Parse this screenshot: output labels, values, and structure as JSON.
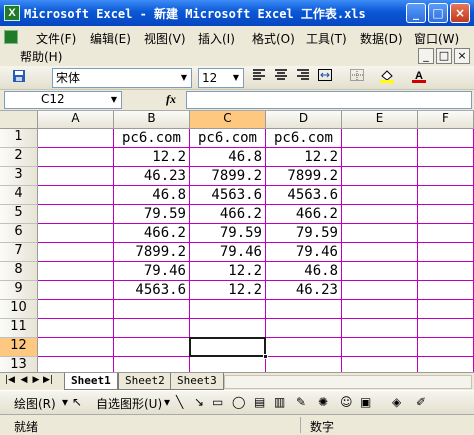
{
  "window": {
    "title": "Microsoft Excel - 新建 Microsoft Excel 工作表.xls",
    "app_icon_letter": "X",
    "minimize": "_",
    "maximize": "□",
    "close": "×"
  },
  "menu": {
    "items": [
      "文件(F)",
      "编辑(E)",
      "视图(V)",
      "插入(I)",
      "格式(O)",
      "工具(T)",
      "数据(D)",
      "窗口(W)"
    ],
    "help": "帮助(H)",
    "doc_controls": [
      "_",
      "□",
      "×"
    ]
  },
  "toolbar": {
    "font_name": "宋体",
    "font_size": "12",
    "font_color": "#d00000",
    "fill_color": "#ffff00"
  },
  "formula_bar": {
    "name_box": "C12",
    "fx_label": "fx",
    "formula": ""
  },
  "grid": {
    "columns": [
      "A",
      "B",
      "C",
      "D",
      "E",
      "F"
    ],
    "active_column": "C",
    "active_row": 12,
    "rows": [
      {
        "num": "1",
        "cells": [
          "",
          "pc6.com",
          "pc6.com",
          "pc6.com",
          "",
          ""
        ]
      },
      {
        "num": "2",
        "cells": [
          "",
          "12.2",
          "46.8",
          "12.2",
          "",
          ""
        ]
      },
      {
        "num": "3",
        "cells": [
          "",
          "46.23",
          "7899.2",
          "7899.2",
          "",
          ""
        ]
      },
      {
        "num": "4",
        "cells": [
          "",
          "46.8",
          "4563.6",
          "4563.6",
          "",
          ""
        ]
      },
      {
        "num": "5",
        "cells": [
          "",
          "79.59",
          "466.2",
          "466.2",
          "",
          ""
        ]
      },
      {
        "num": "6",
        "cells": [
          "",
          "466.2",
          "79.59",
          "79.59",
          "",
          ""
        ]
      },
      {
        "num": "7",
        "cells": [
          "",
          "7899.2",
          "79.46",
          "79.46",
          "",
          ""
        ]
      },
      {
        "num": "8",
        "cells": [
          "",
          "79.46",
          "12.2",
          "46.8",
          "",
          ""
        ]
      },
      {
        "num": "9",
        "cells": [
          "",
          "4563.6",
          "12.2",
          "46.23",
          "",
          ""
        ]
      },
      {
        "num": "10",
        "cells": [
          "",
          "",
          "",
          "",
          "",
          ""
        ]
      },
      {
        "num": "11",
        "cells": [
          "",
          "",
          "",
          "",
          "",
          ""
        ]
      },
      {
        "num": "12",
        "cells": [
          "",
          "",
          "",
          "",
          "",
          ""
        ]
      },
      {
        "num": "13",
        "cells": [
          "",
          "",
          "",
          "",
          "",
          ""
        ]
      },
      {
        "num": "14",
        "cells": [
          "",
          "",
          "",
          "",
          "",
          ""
        ]
      }
    ],
    "gridline_color": "#c000c0"
  },
  "sheets": {
    "tabs": [
      "Sheet1",
      "Sheet2",
      "Sheet3"
    ],
    "active": "Sheet1"
  },
  "drawing": {
    "draw_label": "绘图(R)",
    "autoshapes_label": "自选图形(U)"
  },
  "status": {
    "left": "就绪",
    "right": "数字"
  }
}
